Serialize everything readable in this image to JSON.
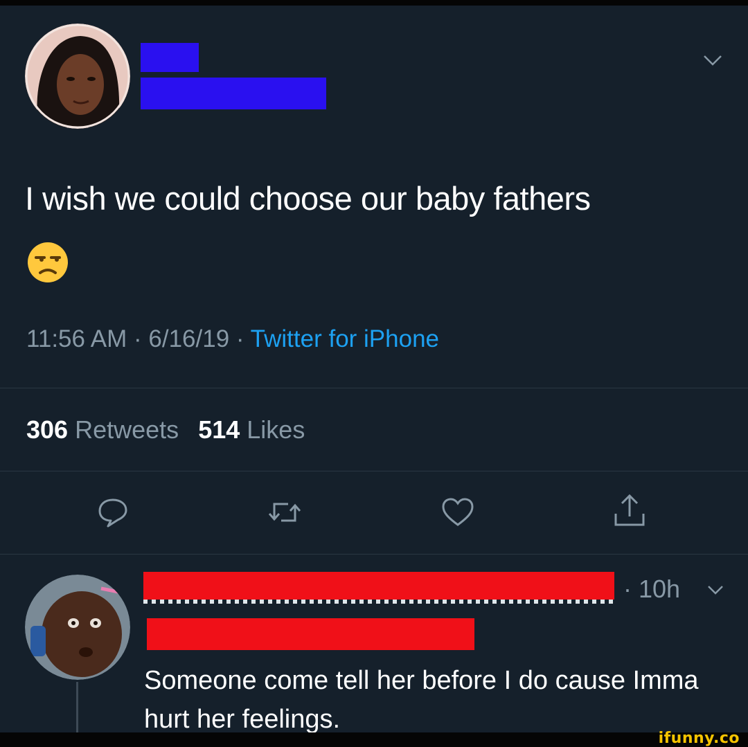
{
  "tweet": {
    "text": "I wish we could choose our baby fathers",
    "emoji_name": "unamused-face-emoji",
    "time": "11:56 AM",
    "date": "6/16/19",
    "separator": "·",
    "source": "Twitter for iPhone",
    "retweets_count": "306",
    "retweets_label": "Retweets",
    "likes_count": "514",
    "likes_label": "Likes"
  },
  "actions": [
    {
      "icon": "reply-icon"
    },
    {
      "icon": "retweet-icon"
    },
    {
      "icon": "like-heart-icon"
    },
    {
      "icon": "share-icon"
    }
  ],
  "reply": {
    "time": "· 10h",
    "text": "Someone come tell her before I do cause Imma hurt her feelings."
  },
  "watermark": "ifunny.co",
  "colors": {
    "background": "#15202b",
    "text": "#ffffff",
    "secondary_text": "#8899a6",
    "link": "#1da1f2",
    "redaction_blue": "#2a10f0",
    "redaction_red": "#f01018",
    "watermark": "#f5c400"
  }
}
